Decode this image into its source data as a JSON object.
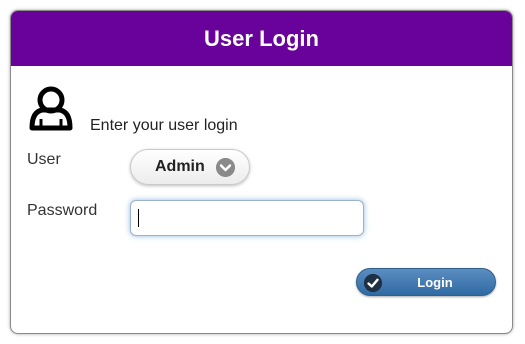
{
  "dialog": {
    "title": "User Login",
    "prompt": "Enter your user login",
    "icon": "user-icon"
  },
  "form": {
    "user_label": "User",
    "user_selected": "Admin",
    "password_label": "Password",
    "password_value": "",
    "submit_label": "Login"
  },
  "colors": {
    "header": "#68029a",
    "button": "#3f78b0"
  }
}
